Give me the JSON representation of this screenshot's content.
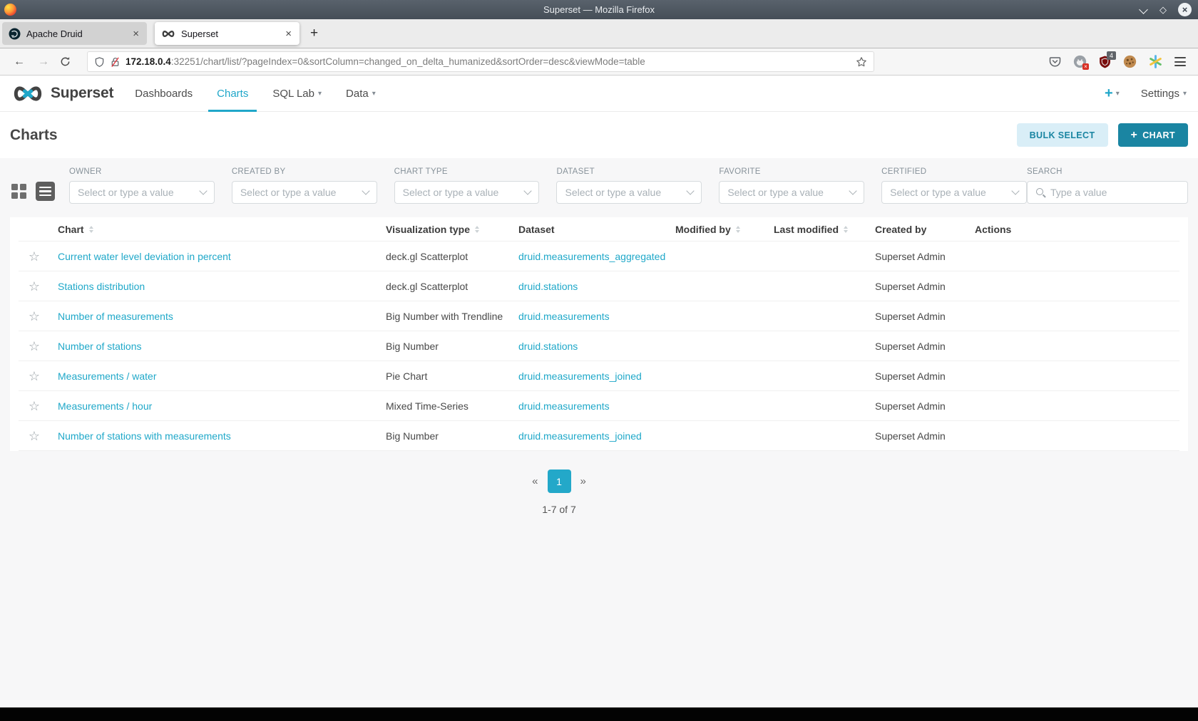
{
  "colors": {
    "accent": "#20a7c9",
    "accent_dark": "#1a85a2",
    "link": "#1fa8c9",
    "bulk_select_bg": "#d9eef7",
    "titlebar": "#4d565f",
    "page_bg": "#f7f7f8"
  },
  "icons": {
    "favorite_star": "☆",
    "caret": "▾",
    "close": "×",
    "plus": "+",
    "back": "←",
    "forward": "→",
    "diamond": "◇"
  },
  "browser": {
    "window_title": "Superset — Mozilla Firefox",
    "tabs": [
      {
        "label": "Apache Druid",
        "active": false
      },
      {
        "label": "Superset",
        "active": true
      }
    ],
    "address": {
      "host": "172.18.0.4",
      "path": ":32251/chart/list/?pageIndex=0&sortColumn=changed_on_delta_humanized&sortOrder=desc&viewMode=table"
    },
    "ublock_badge": "4"
  },
  "app": {
    "brand": "Superset",
    "nav": [
      {
        "label": "Dashboards",
        "active": false
      },
      {
        "label": "Charts",
        "active": true
      },
      {
        "label": "SQL Lab",
        "active": false
      },
      {
        "label": "Data",
        "active": false
      }
    ],
    "settings_label": "Settings"
  },
  "page": {
    "title": "Charts",
    "bulk_select": "BULK SELECT",
    "new_chart": "CHART"
  },
  "filters": [
    {
      "label": "OWNER",
      "placeholder": "Select or type a value"
    },
    {
      "label": "CREATED BY",
      "placeholder": "Select or type a value"
    },
    {
      "label": "CHART TYPE",
      "placeholder": "Select or type a value"
    },
    {
      "label": "DATASET",
      "placeholder": "Select or type a value"
    },
    {
      "label": "FAVORITE",
      "placeholder": "Select or type a value"
    },
    {
      "label": "CERTIFIED",
      "placeholder": "Select or type a value"
    }
  ],
  "search": {
    "label": "SEARCH",
    "placeholder": "Type a value"
  },
  "table": {
    "columns": [
      {
        "label": "Chart",
        "sortable": true
      },
      {
        "label": "Visualization type",
        "sortable": true
      },
      {
        "label": "Dataset",
        "sortable": false
      },
      {
        "label": "Modified by",
        "sortable": true
      },
      {
        "label": "Last modified",
        "sortable": true
      },
      {
        "label": "Created by",
        "sortable": false
      },
      {
        "label": "Actions",
        "sortable": false
      }
    ],
    "rows": [
      {
        "chart": "Current water level deviation in percent",
        "viz_type": "deck.gl Scatterplot",
        "dataset": "druid.measurements_aggregated",
        "modified_by": "",
        "last_modified": "",
        "created_by": "Superset Admin"
      },
      {
        "chart": "Stations distribution",
        "viz_type": "deck.gl Scatterplot",
        "dataset": "druid.stations",
        "modified_by": "",
        "last_modified": "",
        "created_by": "Superset Admin"
      },
      {
        "chart": "Number of measurements",
        "viz_type": "Big Number with Trendline",
        "dataset": "druid.measurements",
        "modified_by": "",
        "last_modified": "",
        "created_by": "Superset Admin"
      },
      {
        "chart": "Number of stations",
        "viz_type": "Big Number",
        "dataset": "druid.stations",
        "modified_by": "",
        "last_modified": "",
        "created_by": "Superset Admin"
      },
      {
        "chart": "Measurements / water",
        "viz_type": "Pie Chart",
        "dataset": "druid.measurements_joined",
        "modified_by": "",
        "last_modified": "",
        "created_by": "Superset Admin"
      },
      {
        "chart": "Measurements / hour",
        "viz_type": "Mixed Time-Series",
        "dataset": "druid.measurements",
        "modified_by": "",
        "last_modified": "",
        "created_by": "Superset Admin"
      },
      {
        "chart": "Number of stations with measurements",
        "viz_type": "Big Number",
        "dataset": "druid.measurements_joined",
        "modified_by": "",
        "last_modified": "",
        "created_by": "Superset Admin"
      }
    ]
  },
  "pagination": {
    "prev": "«",
    "page": "1",
    "next": "»",
    "summary": "1-7 of 7"
  }
}
